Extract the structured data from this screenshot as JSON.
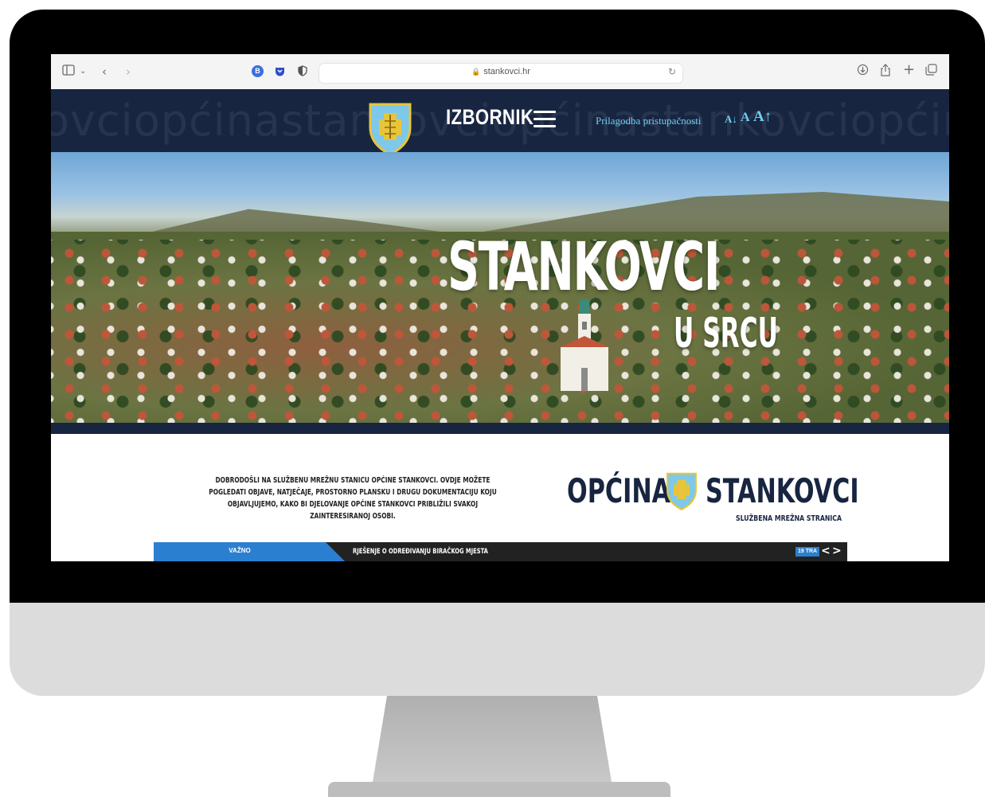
{
  "browser": {
    "url": "stankovci.hr",
    "icons": [
      "sidebar-icon",
      "chevron-down-icon",
      "back-icon",
      "forward-icon",
      "extension-b-icon",
      "pocket-icon",
      "shield-icon",
      "reload-icon",
      "download-icon",
      "share-icon",
      "new-tab-icon",
      "tabs-overview-icon"
    ]
  },
  "header": {
    "watermark": "ovciopćinastankovciopćinastankovciopćinastank",
    "menu_label": "IZBORNIK",
    "accessibility_label": "Prilagodba pristupačnosti",
    "font_controls": [
      "A↓",
      "A",
      "A↑"
    ]
  },
  "hero": {
    "title": "STANKOVCI",
    "subtitle": "U SRCU"
  },
  "intro": {
    "text": "DOBRODOŠLI NA SLUŽBENU MREŽNU STANICU OPĆINE STANKOVCI. OVDJE MOŽETE POGLEDATI OBJAVE, NATJEČAJE, PROSTORNO PLANSKU I DRUGU DOKUMENTACIJU KOJU OBJAVLJUJEMO, KAKO BI DJELOVANJE OPĆINE STANKOVCI PRIBLIŽILI SVAKOJ ZAINTERESIRANOJ OSOBI."
  },
  "brand": {
    "word_left": "OPĆINA",
    "word_right": "STANKOVCI",
    "subtitle": "SLUŽBENA MREŽNA STRANICA"
  },
  "ticker": {
    "tag": "VAŽNO",
    "headline": "RJEŠENJE O ODREĐIVANJU BIRAČKOG MJESTA",
    "date": "19 TRA",
    "prev": "<",
    "next": ">"
  },
  "colors": {
    "navy": "#172541",
    "accent_blue": "#2b7fd0",
    "accessibility_cyan": "#6fd0ef",
    "shield_blue": "#7ec8ea",
    "shield_gold": "#e8c43a"
  }
}
